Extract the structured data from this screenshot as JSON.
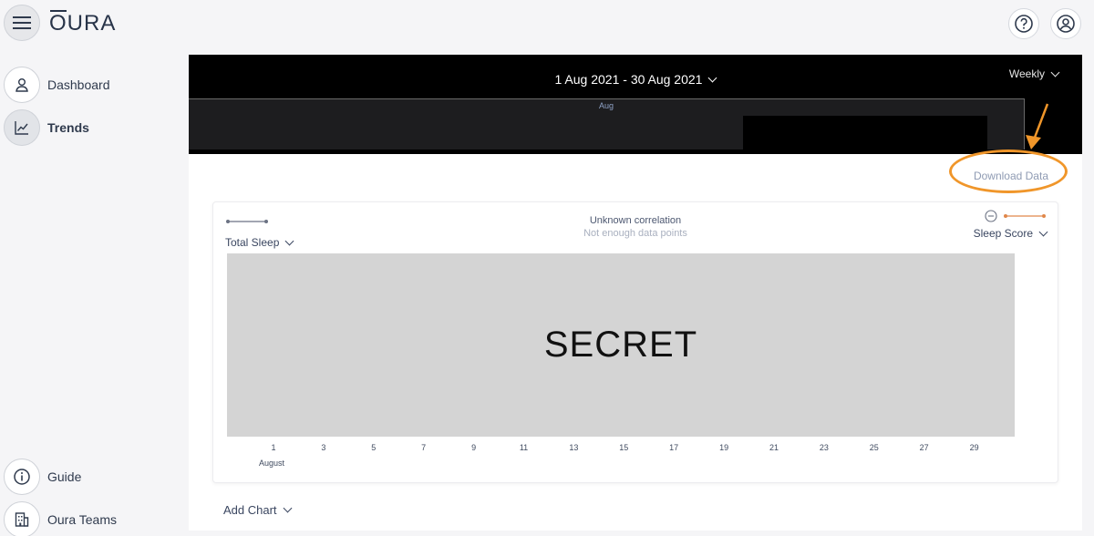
{
  "header": {
    "logo": "OURA",
    "logo_first": "O",
    "logo_rest": "URA",
    "help_icon": "question-circle-icon",
    "profile_icon": "user-circle-icon"
  },
  "sidebar": {
    "items": [
      {
        "label": "Dashboard",
        "icon": "user-icon"
      },
      {
        "label": "Trends",
        "icon": "trend-chart-icon",
        "active": true
      },
      {
        "label": "Guide",
        "icon": "info-icon"
      },
      {
        "label": "Oura Teams",
        "icon": "building-icon"
      }
    ]
  },
  "range": {
    "date_range": "1 Aug 2021 - 30 Aug 2021",
    "period": "Weekly",
    "navigator_month": "Aug"
  },
  "download_label": "Download Data",
  "chart": {
    "left_series": "Total Sleep",
    "right_series": "Sleep Score",
    "correlation_title": "Unknown correlation",
    "correlation_sub": "Not enough data points",
    "redaction_text": "SECRET",
    "x_ticks": [
      "1",
      "3",
      "5",
      "7",
      "9",
      "11",
      "13",
      "15",
      "17",
      "19",
      "21",
      "23",
      "25",
      "27",
      "29"
    ],
    "x_month": "August",
    "left_series_color": "#6b7283",
    "right_series_color": "#e0874a"
  },
  "add_chart_label": "Add Chart",
  "colors": {
    "annotation": "#f0962a",
    "accent": "#8f9bb3"
  }
}
